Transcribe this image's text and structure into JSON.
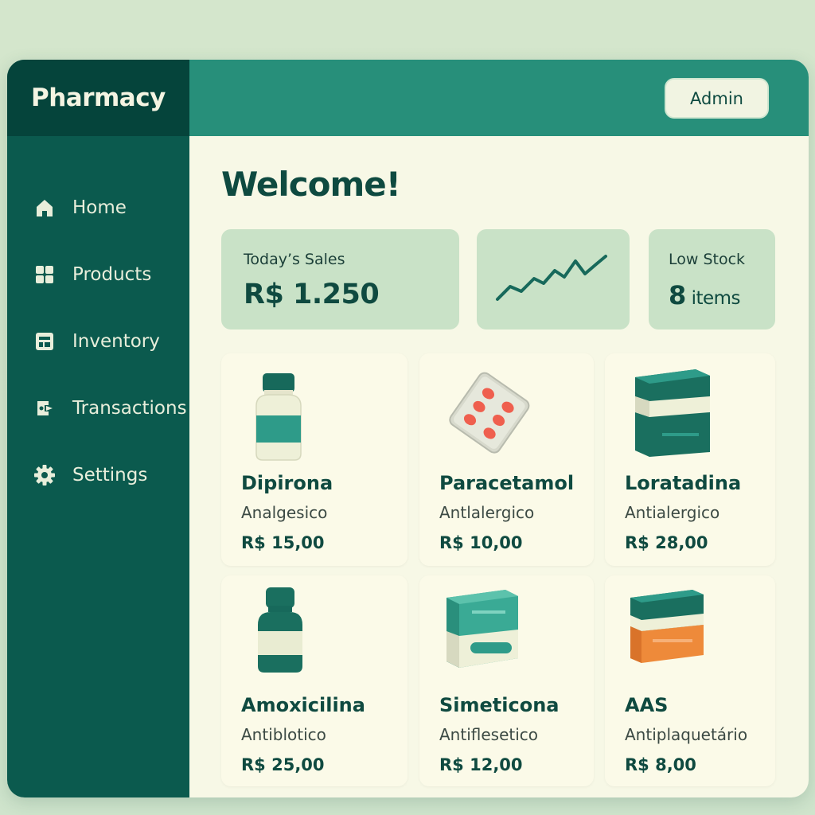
{
  "app": {
    "title": "Pharmacy"
  },
  "header": {
    "admin_label": "Admin"
  },
  "sidebar": {
    "items": [
      {
        "label": "Home",
        "icon": "home-icon"
      },
      {
        "label": "Products",
        "icon": "grid-icon"
      },
      {
        "label": "Inventory",
        "icon": "inventory-icon"
      },
      {
        "label": "Transactions",
        "icon": "transactions-icon"
      },
      {
        "label": "Settings",
        "icon": "gear-icon"
      }
    ]
  },
  "main": {
    "welcome": "Welcome!",
    "stats": {
      "sales_label": "Today’s Sales",
      "sales_value": "R$ 1.250",
      "trend_icon": "trend-line-icon",
      "low_stock_label": "Low Stock",
      "low_stock_count": "8",
      "low_stock_unit": "items"
    },
    "products": [
      {
        "name": "Dipirona",
        "category": "Analgesico",
        "price": "R$ 15,00",
        "icon": "pill-bottle-icon"
      },
      {
        "name": "Paracetamol",
        "category": "Antlalergico",
        "price": "R$ 10,00",
        "icon": "blister-pack-icon"
      },
      {
        "name": "Loratadina",
        "category": "Antialergico",
        "price": "R$ 28,00",
        "icon": "medicine-box-icon"
      },
      {
        "name": "Amoxicilina",
        "category": "Antiblotico",
        "price": "R$ 25,00",
        "icon": "medicine-bottle-icon"
      },
      {
        "name": "Simeticona",
        "category": "Antiflesetico",
        "price": "R$ 12,00",
        "icon": "medicine-box-icon"
      },
      {
        "name": "AAS",
        "category": "Antiplaquetário",
        "price": "R$ 8,00",
        "icon": "medicine-box-icon"
      }
    ]
  },
  "colors": {
    "sidebar": "#0b5a4e",
    "brand_bg": "#05443b",
    "topbar": "#278f7a",
    "content_bg": "#f7f8e6",
    "stat_bg": "#c9e2c7",
    "text_dark": "#0f4a40",
    "pill_red": "#ef5f4e",
    "box_orange": "#ee8a3a"
  }
}
